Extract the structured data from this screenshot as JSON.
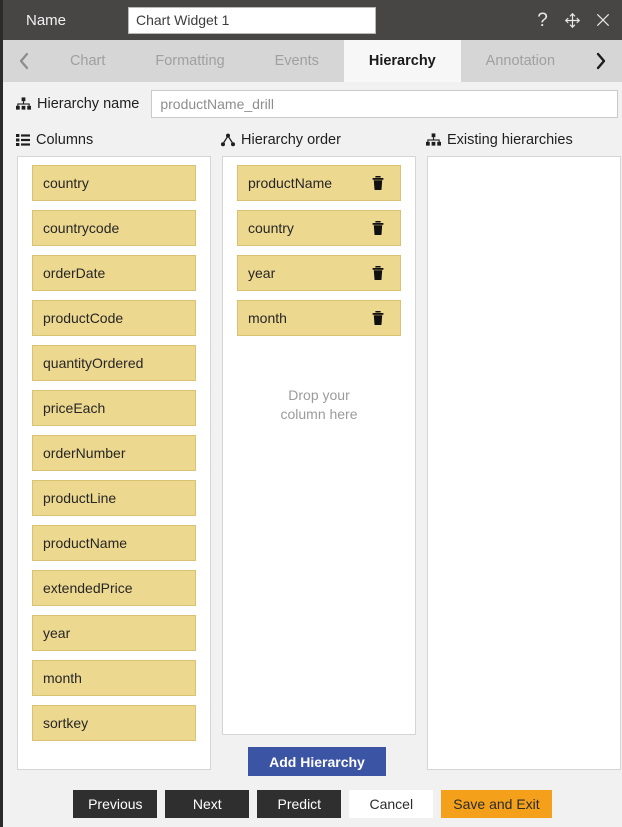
{
  "titlebar": {
    "name_label": "Name",
    "widget_name": "Chart Widget 1",
    "help_icon": "question-mark-icon",
    "move_icon": "move-arrows-icon",
    "close_icon": "close-icon"
  },
  "tabs": {
    "prev_icon": "chevron-left-icon",
    "next_icon": "chevron-right-icon",
    "items": [
      {
        "label": "Chart",
        "active": false
      },
      {
        "label": "Formatting",
        "active": false
      },
      {
        "label": "Events",
        "active": false
      },
      {
        "label": "Hierarchy",
        "active": true
      },
      {
        "label": "Annotation",
        "active": false
      }
    ]
  },
  "hierarchy_name": {
    "icon": "sitemap-icon",
    "label": "Hierarchy name",
    "value": "",
    "placeholder": "productName_drill"
  },
  "sections": {
    "columns": {
      "icon": "list-icon",
      "title": "Columns",
      "items": [
        "country",
        "countrycode",
        "orderDate",
        "productCode",
        "quantityOrdered",
        "priceEach",
        "orderNumber",
        "productLine",
        "productName",
        "extendedPrice",
        "year",
        "month",
        "sortkey"
      ]
    },
    "hierarchy_order": {
      "icon": "hierarchy-node-icon",
      "title": "Hierarchy order",
      "items": [
        {
          "label": "productName",
          "delete_icon": "trash-icon"
        },
        {
          "label": "country",
          "delete_icon": "trash-icon"
        },
        {
          "label": "year",
          "delete_icon": "trash-icon"
        },
        {
          "label": "month",
          "delete_icon": "trash-icon"
        }
      ],
      "drop_hint_line1": "Drop your",
      "drop_hint_line2": "column here"
    },
    "existing_hierarchies": {
      "icon": "sitemap-icon",
      "title": "Existing hierarchies",
      "items": []
    }
  },
  "actions": {
    "add_hierarchy": "Add Hierarchy",
    "previous": "Previous",
    "next": "Next",
    "predict": "Predict",
    "cancel": "Cancel",
    "save_and_exit": "Save and Exit"
  },
  "colors": {
    "titlebar_bg": "#484644",
    "tabbar_bg": "#d6d6d6",
    "active_tab_bg": "#f7f7f7",
    "chip_bg": "#edd88f",
    "chip_border": "#d9c271",
    "add_hierarchy_bg": "#3c54a4",
    "save_exit_bg": "#f5a01b",
    "footer_dark_bg": "#2f2f2f"
  }
}
